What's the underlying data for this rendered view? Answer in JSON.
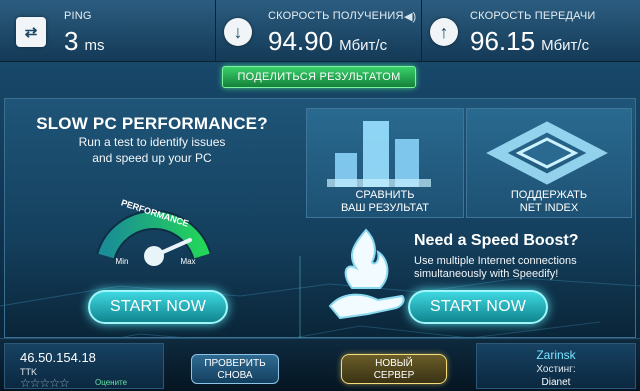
{
  "stats": {
    "ping": {
      "label": "PING",
      "value": "3",
      "unit": "ms",
      "icon": "ping-icon"
    },
    "download": {
      "label": "СКОРОСТЬ ПОЛУЧЕНИЯ",
      "value": "94.90",
      "unit": "Мбит/с",
      "icon": "download-arrow-icon"
    },
    "upload": {
      "label": "СКОРОСТЬ ПЕРЕДАЧИ",
      "value": "96.15",
      "unit": "Мбит/с",
      "icon": "upload-arrow-icon"
    }
  },
  "share_button": "ПОДЕЛИТЬСЯ РЕЗУЛЬТАТОМ",
  "ad_left": {
    "title": "SLOW PC PERFORMANCE?",
    "line1": "Run a test to identify issues",
    "line2": "and speed up your PC",
    "gauge": {
      "label": "PERFORMANCE",
      "min": "Min",
      "max": "Max"
    },
    "button": "START NOW"
  },
  "tiles": {
    "compare": {
      "line1": "СРАВНИТЬ",
      "line2": "ВАШ РЕЗУЛЬТАТ"
    },
    "netindex": {
      "line1": "ПОДДЕРЖАТЬ",
      "line2": "NET INDEX"
    }
  },
  "ad_right": {
    "title": "Need a Speed Boost?",
    "line1": "Use multiple Internet connections",
    "line2": "simultaneously with Speedify!",
    "button": "START NOW"
  },
  "bottom": {
    "ip": "46.50.154.18",
    "isp": "TTK",
    "rate_label": "Оцените",
    "retest": {
      "line1": "ПРОВЕРИТЬ",
      "line2": "СНОВА"
    },
    "new_server": {
      "line1": "НОВЫЙ",
      "line2": "СЕРВЕР"
    },
    "server_city": "Zarinsk",
    "host_label": "Хостинг:",
    "host": "Dianet"
  },
  "colors": {
    "accent_green": "#13813a",
    "accent_cyan": "#3fd7e0",
    "accent_gold": "#f4dd7a"
  }
}
